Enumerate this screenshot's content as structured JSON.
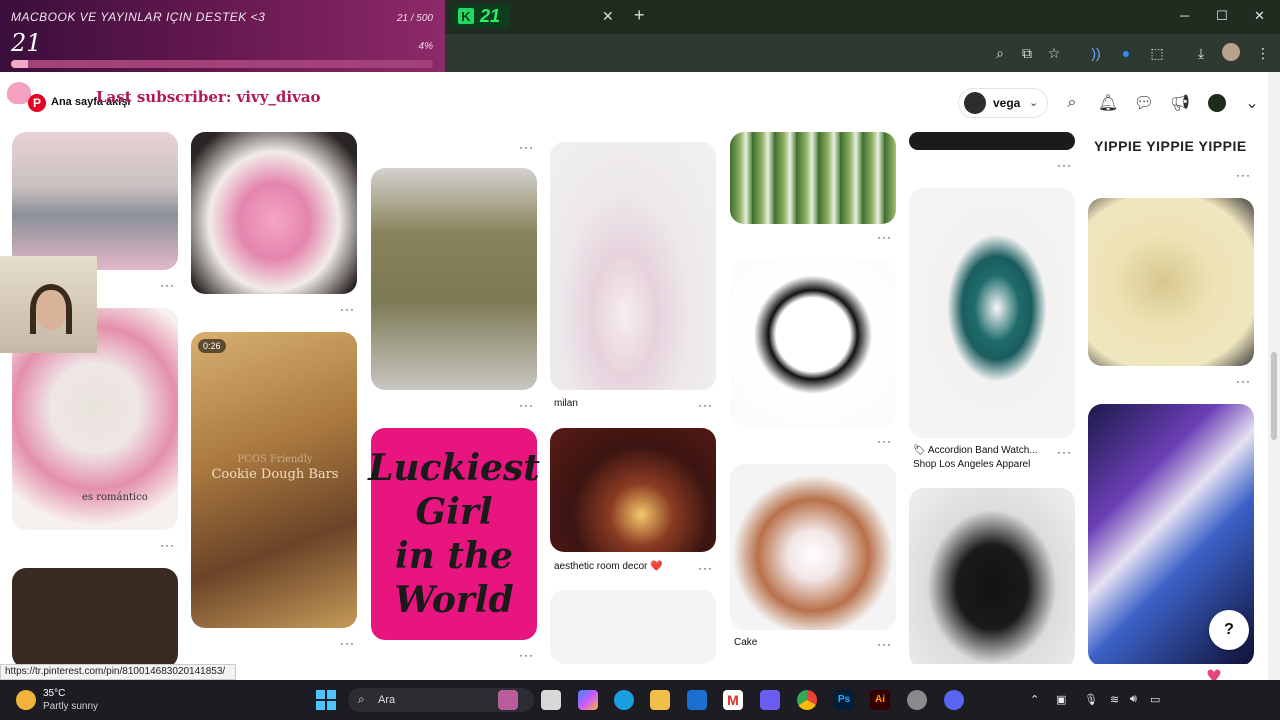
{
  "donation": {
    "title": "MACBOOK VE YAYINLAR IÇIN DESTEK <3",
    "count": "21 / 500",
    "amount": "21",
    "percent": "4%",
    "progress": 0.04
  },
  "browser": {
    "extension_badge": "21",
    "tab_close": "✕",
    "new_tab": "+",
    "window_controls": [
      "─",
      "☐",
      "✕"
    ],
    "toolbar_icons": [
      "zoom-icon",
      "install-icon",
      "bookmark-star-icon",
      "audio-icon",
      "shazam-icon",
      "extensions-icon",
      "download-icon",
      "profile-icon",
      "menu-icon"
    ]
  },
  "header": {
    "home_label": "Ana sayfa akışı",
    "last_subscriber": "Last subscriber: vivy_divao",
    "profile_name": "vega",
    "icons": [
      "search-icon",
      "notifications-icon",
      "messages-icon",
      "updates-icon",
      "account-icon",
      "chevron-down-icon"
    ]
  },
  "pins": {
    "yippie_text": "YIPPIE YIPPIE YIPPIE",
    "video_duration": "0:26",
    "cookie_subtitle": "PCOS Friendly",
    "cookie_title": "Cookie Dough Bars",
    "romantic_text": "es romántico",
    "lucky_lines": [
      "Luckiest",
      "Girl",
      "in the",
      "World"
    ],
    "milan_caption": "milan",
    "aesthetic_caption": "aesthetic room decor ❤️",
    "watch_caption_1": "🏷 Accordion Band Watch...",
    "watch_caption_2": "Shop Los Angeles Apparel",
    "cake_caption": "Cake",
    "more_label": "···"
  },
  "status_url": "https://tr.pinterest.com/pin/810014683020141853/",
  "help_label": "?",
  "taskbar": {
    "temperature": "35°C",
    "weather": "Partly sunny",
    "search_placeholder": "Ara"
  },
  "colors": {
    "pinterest_red": "#e60023",
    "lucky_pink": "#e9157f",
    "overlay_purple": "#6a1a52"
  }
}
